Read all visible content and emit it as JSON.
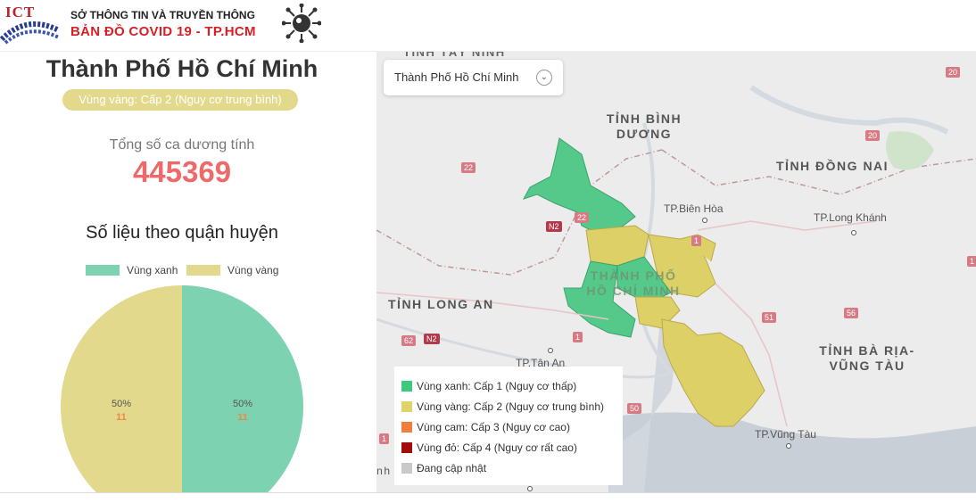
{
  "header": {
    "logo_text": "ICT",
    "org": "SỞ THÔNG TIN VÀ TRUYỀN THÔNG",
    "title": "BẢN ĐỒ  COVID 19 - TP.HCM"
  },
  "summary": {
    "city": "Thành Phố Hồ Chí Minh",
    "zone_badge": "Vùng vàng: Cấp 2 (Nguy cơ trung bình)",
    "total_label": "Tổng số ca dương tính",
    "total_value": "445369",
    "district_title": "Số liệu theo quận huyện"
  },
  "colors": {
    "green": "#7dd3b1",
    "yellow": "#e2d98c",
    "orange": "#f08844",
    "red": "#a80c0c",
    "grey": "#cccccc",
    "map_green": "#55c98a",
    "map_yellow": "#dcd067"
  },
  "chart_data": {
    "type": "pie",
    "legend": [
      "Vùng xanh",
      "Vùng vàng"
    ],
    "slices": [
      {
        "name": "Vùng xanh",
        "percent_label": "50%",
        "count": 11,
        "color": "#7dd3b1"
      },
      {
        "name": "Vùng vàng",
        "percent_label": "50%",
        "count": 11,
        "color": "#e2d98c"
      }
    ]
  },
  "map": {
    "selector": {
      "value": "Thành Phố Hồ Chí Minh"
    },
    "regions": {
      "binh_duong": "TỈNH BÌNH\nDƯƠNG",
      "dong_nai": "TỈNH ĐỒNG NAI",
      "long_an": "TỈNH LONG AN",
      "ba_ria": "TỈNH BÀ RỊA-\nVŨNG TÀU",
      "tay_ninh": "TỈNH TÂY NINH",
      "hcm": "THÀNH PHỐ\nHỒ CHÍ MINH",
      "partial": "ỉnh l"
    },
    "cities": {
      "bien_hoa": "TP.Biên Hòa",
      "long_khanh": "TP.Long Khánh",
      "tan_an": "TP.Tân An",
      "vung_tau": "TP.Vũng Tàu"
    },
    "roads": [
      "20",
      "20",
      "22",
      "22",
      "N2",
      "1",
      "51",
      "56",
      "62",
      "N2",
      "1",
      "50",
      "1",
      "1"
    ],
    "legend": [
      {
        "label": "Vùng xanh: Cấp 1 (Nguy cơ thấp)",
        "color": "#3fc97e"
      },
      {
        "label": "Vùng vàng: Cấp 2 (Nguy cơ trung bình)",
        "color": "#e0d36a"
      },
      {
        "label": "Vùng cam: Cấp 3 (Nguy cơ cao)",
        "color": "#f07f3c"
      },
      {
        "label": "Vùng đỏ: Cấp 4 (Nguy cơ rất cao)",
        "color": "#a10d0d"
      },
      {
        "label": "Đang cập nhật",
        "color": "#c9c9c9"
      }
    ]
  }
}
